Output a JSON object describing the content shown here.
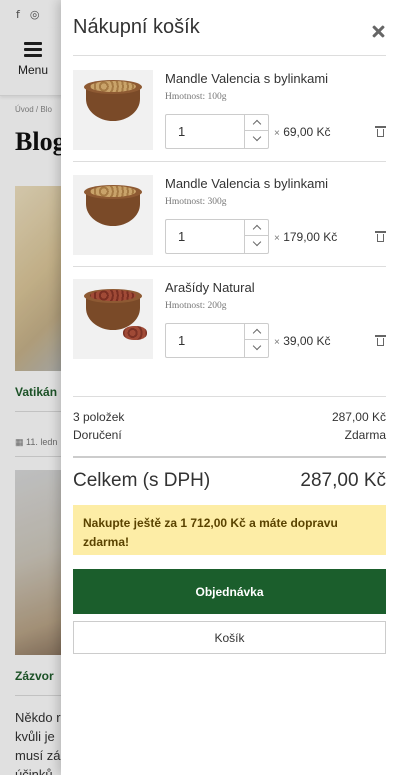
{
  "background_page": {
    "social": [
      "f",
      "◎"
    ],
    "menu_label": "Menu",
    "breadcrumb": "Úvod / Blo",
    "title": "Blog",
    "post1_link": "Vatikán",
    "post1_date": "11. ledn",
    "post2_link": "Zázvor",
    "post2_text": [
      "Někdo r",
      "kvůli je",
      "musí zá",
      "účinků"
    ]
  },
  "cart": {
    "title": "Nákupní košík",
    "items": [
      {
        "name": "Mandle Valencia s bylinkami",
        "weight": "Hmotnost: 100g",
        "qty": "1",
        "price": "69,00 Kč",
        "image": "almonds"
      },
      {
        "name": "Mandle Valencia s bylinkami",
        "weight": "Hmotnost: 300g",
        "qty": "1",
        "price": "179,00 Kč",
        "image": "almonds"
      },
      {
        "name": "Arašídy Natural",
        "weight": "Hmotnost: 200g",
        "qty": "1",
        "price": "39,00 Kč",
        "image": "peanuts"
      }
    ],
    "multiply_sign": "×",
    "count_label": "3 položek",
    "subtotal": "287,00 Kč",
    "shipping_label": "Doručení",
    "shipping_value": "Zdarma",
    "total_label": "Celkem (s DPH)",
    "total_value": "287,00 Kč",
    "free_shipping_notice": "Nakupte ještě za 1 712,00 Kč a máte dopravu zdarma!",
    "order_button": "Objednávka",
    "cart_button": "Košík"
  },
  "colors": {
    "accent_green": "#1b5e2c",
    "notice_yellow": "#fdeda6"
  },
  "icons": [
    "facebook-icon",
    "instagram-icon",
    "hamburger-menu-icon",
    "close-icon",
    "trash-icon",
    "chevron-up-icon",
    "chevron-down-icon",
    "calendar-icon"
  ]
}
